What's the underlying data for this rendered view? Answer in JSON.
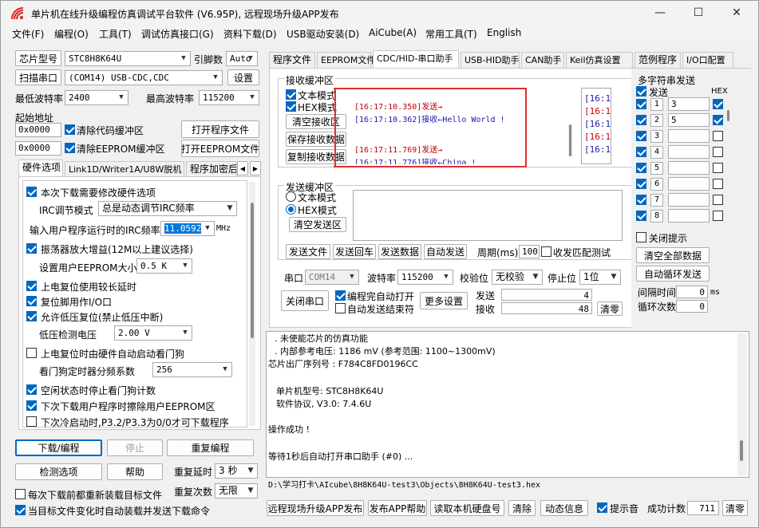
{
  "window": {
    "title": "单片机在线升级编程仿真调试平台软件 (V6.95P), 远程现场升级APP发布"
  },
  "menu": [
    "文件(F)",
    "编程(O)",
    "工具(T)",
    "调试仿真接口(G)",
    "资料下载(D)",
    "USB驱动安装(D)",
    "AiCube(A)",
    "常用工具(T)",
    "English"
  ],
  "left": {
    "chip_label": "芯片型号",
    "chip_value": "STC8H8K64U",
    "pins_label": "引脚数",
    "pins_value": "Auto",
    "scan_button": "扫描串口",
    "port_value": "(COM14) USB-CDC,CDC",
    "settings_button": "设置",
    "min_baud_label": "最低波特率",
    "min_baud_value": "2400",
    "max_baud_label": "最高波特率",
    "max_baud_value": "115200",
    "start_addr_label": "起始地址",
    "addr1_value": "0x0000",
    "clear_code_label": "清除代码缓冲区",
    "open_prog_button": "打开程序文件",
    "addr2_value": "0x0000",
    "clear_eeprom_label": "清除EEPROM缓冲区",
    "open_eeprom_button": "打开EEPROM文件",
    "tabs": [
      "硬件选项",
      "Link1D/Writer1A/U8W脱机",
      "程序加密后"
    ],
    "hw": {
      "modify_hw": "本次下载需要修改硬件选项",
      "irc_mode_label": "IRC调节模式",
      "irc_mode_value": "总是动态调节IRC频率",
      "irc_freq_label": "输入用户程序运行时的IRC频率",
      "irc_freq_value": "11.0592",
      "irc_unit": "MHz",
      "osc_gain": "振荡器放大增益(12M以上建议选择)",
      "eeprom_size_label": "设置用户EEPROM大小",
      "eeprom_size_value": "0.5 K",
      "long_delay": "上电复位使用较长延时",
      "reset_io": "复位脚用作I/O口",
      "low_volt_reset": "允许低压复位(禁止低压中断)",
      "low_volt_label": "低压检测电压",
      "low_volt_value": "2.00 V",
      "wdt_hw": "上电复位时由硬件自动启动看门狗",
      "wdt_div_label": "看门狗定时器分频系数",
      "wdt_div_value": "256",
      "idle_stop_wdt": "空闲状态时停止看门狗计数",
      "erase_eeprom": "下次下载用户程序时擦除用户EEPROM区",
      "cold_start": "下次冷启动时,P3.2/P3.3为0/0才可下载程序"
    },
    "download_button": "下载/编程",
    "stop_button": "停止",
    "repeat_button": "重复编程",
    "check_button": "检测选项",
    "help_button": "帮助",
    "repeat_delay_label": "重复延时",
    "repeat_delay_value": "3 秒",
    "repeat_count_label": "重复次数",
    "repeat_count_value": "无限",
    "reload_label": "每次下载前都重新装载目标文件",
    "auto_load_label": "当目标文件变化时自动装载并发送下载命令"
  },
  "right": {
    "tabs": [
      "程序文件",
      "EEPROM文件",
      "CDC/HID-串口助手",
      "USB-HID助手",
      "CAN助手",
      "Keil仿真设置",
      "范例程序",
      "I/O口配置"
    ],
    "recv": {
      "title": "接收缓冲区",
      "text_mode": "文本模式",
      "hex_mode": "HEX模式",
      "clear_button": "清空接收区",
      "save_button": "保存接收数据",
      "copy_button": "复制接收数据",
      "log": [
        {
          "text": "[16:17:10.350]发送→",
          "color": "#c00000"
        },
        {
          "text": "[16:17:10.362]接收←Hello World !",
          "color": "#1a1aa6"
        },
        {
          "text": "",
          "color": "#000"
        },
        {
          "text": "[16:17:11.769]发送→",
          "color": "#c00000"
        },
        {
          "text": "[16:17:11.776]接收←China !",
          "color": "#1a1aa6"
        }
      ],
      "side_log": [
        {
          "text": "[16:1",
          "color": "#1a1aa6"
        },
        {
          "text": "[16:1",
          "color": "#c00000"
        },
        {
          "text": "[16:1",
          "color": "#1a1aa6"
        },
        {
          "text": "[16:1",
          "color": "#c00000"
        },
        {
          "text": "[16:1",
          "color": "#1a1aa6"
        }
      ]
    },
    "send": {
      "title": "发送缓冲区",
      "text_mode": "文本模式",
      "hex_mode": "HEX模式",
      "clear_button": "清空发送区",
      "send_file": "发送文件",
      "send_enter": "发送回车",
      "send_data": "发送数据",
      "auto_send": "自动发送",
      "period_label": "周期(ms)",
      "period_value": "100",
      "match_label": "收发匹配测试"
    },
    "serial": {
      "port_label": "串口",
      "port_value": "COM14",
      "baud_label": "波特率",
      "baud_value": "115200",
      "parity_label": "校验位",
      "parity_value": "无校验",
      "stop_label": "停止位",
      "stop_value": "1位",
      "close_button": "关闭串口",
      "auto_open": "编程完自动打开",
      "auto_send_end": "自动发送结束符",
      "more_button": "更多设置",
      "send_label": "发送",
      "send_count": "4",
      "recv_label": "接收",
      "recv_count": "48",
      "clear_button": "清零"
    },
    "multi": {
      "title": "多字符串发送",
      "send_header": "发送",
      "hex_header": "HEX",
      "rows": [
        {
          "n": "1",
          "value": "3",
          "hex": true
        },
        {
          "n": "2",
          "value": "5",
          "hex": true
        },
        {
          "n": "3",
          "value": "",
          "hex": false
        },
        {
          "n": "4",
          "value": "",
          "hex": false
        },
        {
          "n": "5",
          "value": "",
          "hex": false
        },
        {
          "n": "6",
          "value": "",
          "hex": false
        },
        {
          "n": "7",
          "value": "",
          "hex": false
        },
        {
          "n": "8",
          "value": "",
          "hex": false
        }
      ],
      "close_tip": "关闭提示",
      "clear_all": "清空全部数据",
      "auto_loop": "自动循环发送",
      "interval_label": "间隔时间",
      "interval_value": "0",
      "interval_unit": "ms",
      "loop_label": "循环次数",
      "loop_value": "0"
    },
    "output": [
      ". 未使能芯片的仿真功能",
      ". 内部参考电压: 1186 mV (参考范围: 1100~1300mV)",
      "芯片出厂序列号 : F784C8FD0196CC",
      "",
      "单片机型号: STC8H8K64U",
      "软件协议, V3.0: 7.4.6U",
      "",
      "操作成功 !",
      "",
      "等待1秒后自动打开串口助手 (#0) ..."
    ],
    "path": "D:\\学习打卡\\AIcube\\8H8K64U-test3\\Objects\\8H8K64U-test3.hex",
    "bottom": {
      "publish_app": "远程现场升级APP发布",
      "publish_help": "发布APP帮助",
      "read_disk": "读取本机硬盘号",
      "clear": "清除",
      "anim": "动态信息",
      "beep": "提示音",
      "success_label": "成功计数",
      "success_value": "711",
      "clear2": "清零"
    }
  }
}
